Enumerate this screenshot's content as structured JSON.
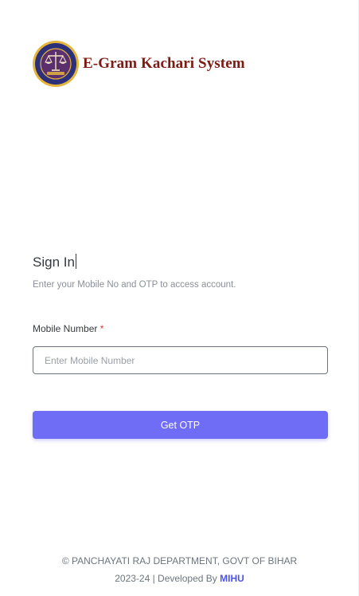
{
  "brand": {
    "title": "E-Gram Kachari System",
    "logo_icon": "scales-of-justice-emblem-icon",
    "logo_colors": {
      "ring": "#2c2f7a",
      "inner": "#5b2e6e",
      "accent": "#e3b53d"
    }
  },
  "signin": {
    "title": "Sign In",
    "subtitle": "Enter your Mobile No and OTP to access account."
  },
  "mobile_field": {
    "label": "Mobile Number",
    "required_mark": "*",
    "placeholder": "Enter Mobile Number",
    "value": ""
  },
  "actions": {
    "get_otp_label": "Get OTP"
  },
  "footer": {
    "line1": "© PANCHAYATI RAJ DEPARTMENT, GOVT OF BIHAR",
    "line2_prefix": "2023-24 | Developed By",
    "developer": "MIHU"
  },
  "colors": {
    "brand_title": "#7a1b14",
    "primary_button": "#6f6cf5",
    "required": "#e3342f",
    "link": "#4e54e8"
  }
}
